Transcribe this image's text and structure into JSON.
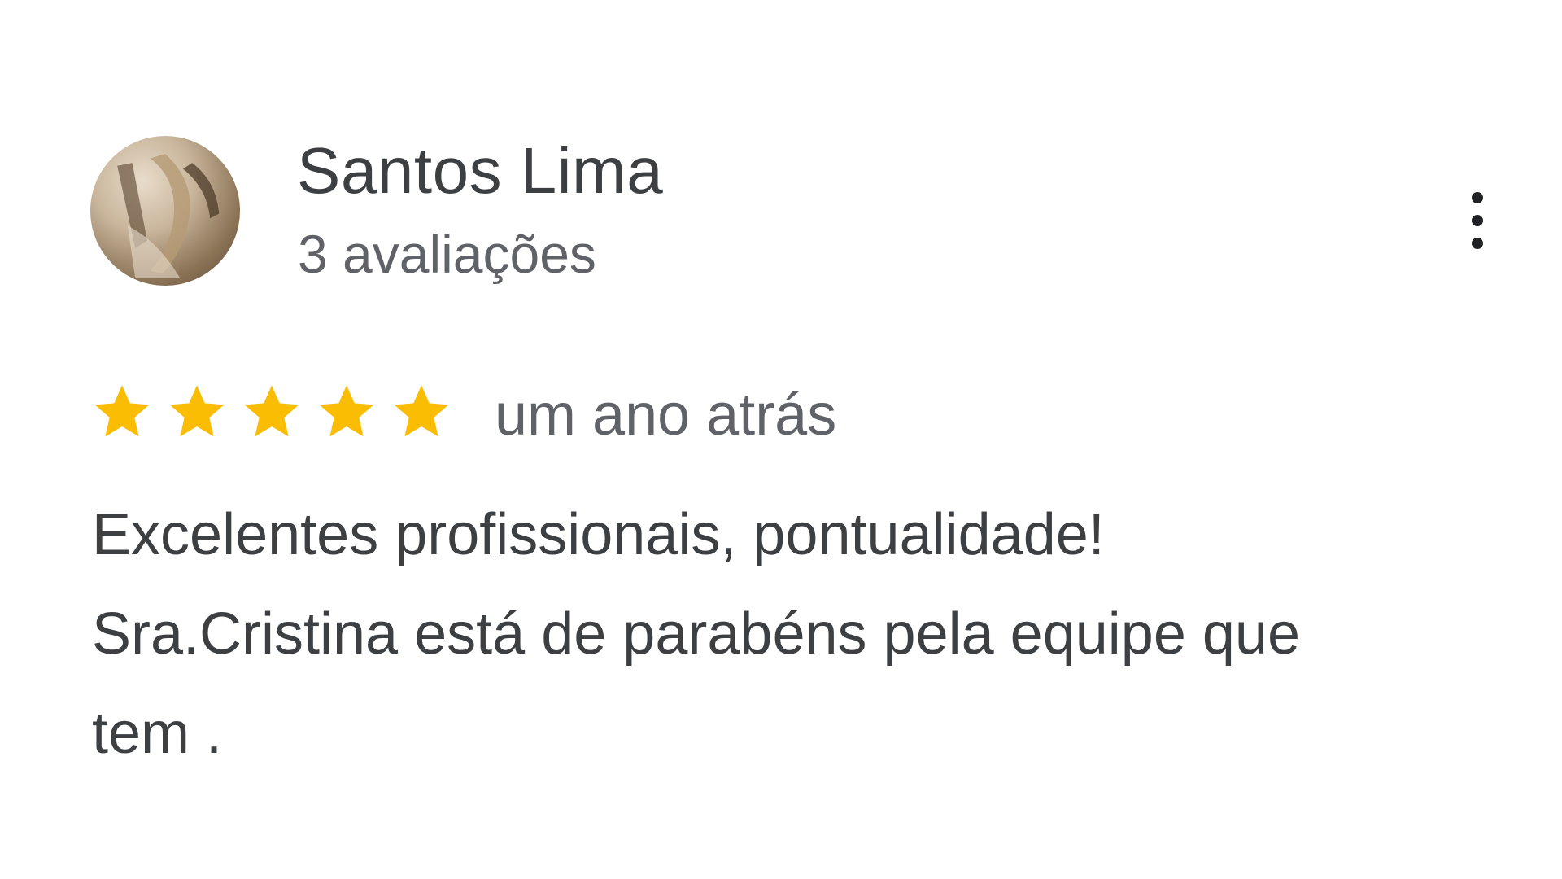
{
  "review": {
    "author": {
      "name": "Santos Lima",
      "reviews_count": "3 avaliações",
      "avatar_icon": "avatar-photo"
    },
    "more_icon": "more-vert-icon",
    "rating": {
      "value": 5,
      "max": 5,
      "star_color": "#fbbc04"
    },
    "date": "um ano atrás",
    "text_lines": [
      "Excelentes profissionais, pontualidade!",
      "Sra.Cristina está de parabéns pela equipe que",
      "tem ."
    ]
  },
  "colors": {
    "name": "#3c4043",
    "secondary": "#5f6368",
    "star": "#fbbc04",
    "background": "#ffffff"
  }
}
